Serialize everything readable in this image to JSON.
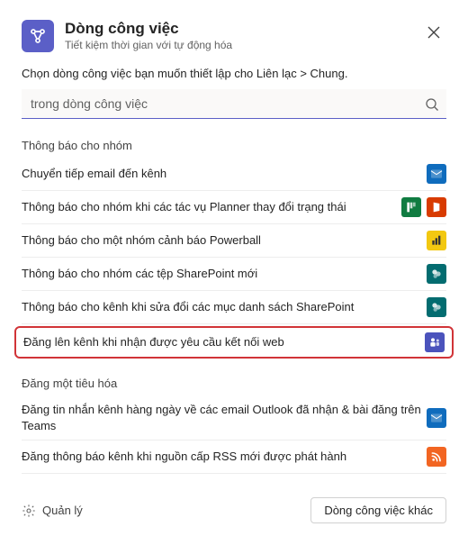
{
  "header": {
    "title": "Dòng công việc",
    "subtitle": "Tiết kiệm thời gian với tự động hóa"
  },
  "prompt": "Chọn dòng công việc bạn muốn thiết lập cho Liên lạc &gt; Chung.",
  "search": {
    "placeholder": "trong dòng công việc"
  },
  "sections": [
    {
      "heading": "Thông báo cho nhóm",
      "items": [
        {
          "label": "Chuyển tiếp email đến kênh",
          "icons": [
            "outlook"
          ],
          "highlighted": false
        },
        {
          "label": "Thông báo cho nhóm khi các tác vụ Planner thay đổi trạng thái",
          "icons": [
            "planner",
            "office"
          ],
          "highlighted": false
        },
        {
          "label": "Thông báo cho một nhóm cảnh báo Powerball",
          "icons": [
            "powerbi"
          ],
          "highlighted": false
        },
        {
          "label": "Thông báo cho nhóm các tệp SharePoint mới",
          "icons": [
            "sharepoint"
          ],
          "highlighted": false
        },
        {
          "label": "Thông báo cho kênh khi sửa đổi các mục danh sách SharePoint",
          "icons": [
            "sharepoint"
          ],
          "highlighted": false
        },
        {
          "label": "Đăng lên kênh khi nhận được yêu cầu kết nối web",
          "icons": [
            "teams"
          ],
          "highlighted": true
        }
      ]
    },
    {
      "heading": "Đăng một tiêu hóa",
      "items": [
        {
          "label": "Đăng tin nhắn kênh hàng ngày về các email Outlook đã nhận &amp; bài đăng trên Teams",
          "icons": [
            "outlook"
          ],
          "highlighted": false
        },
        {
          "label": "Đăng thông báo kênh khi nguồn cấp RSS mới được phát hành",
          "icons": [
            "rss"
          ],
          "highlighted": false
        }
      ]
    }
  ],
  "footer": {
    "manage": "Quản lý",
    "more": "Dòng công việc khác"
  },
  "icon_colors": {
    "outlook": "#0f6cbd",
    "planner": "#107c41",
    "office": "#d83b01",
    "powerbi": "#f2c811",
    "sharepoint": "#036c70",
    "teams": "#4b53bc",
    "rss": "#f26522"
  }
}
